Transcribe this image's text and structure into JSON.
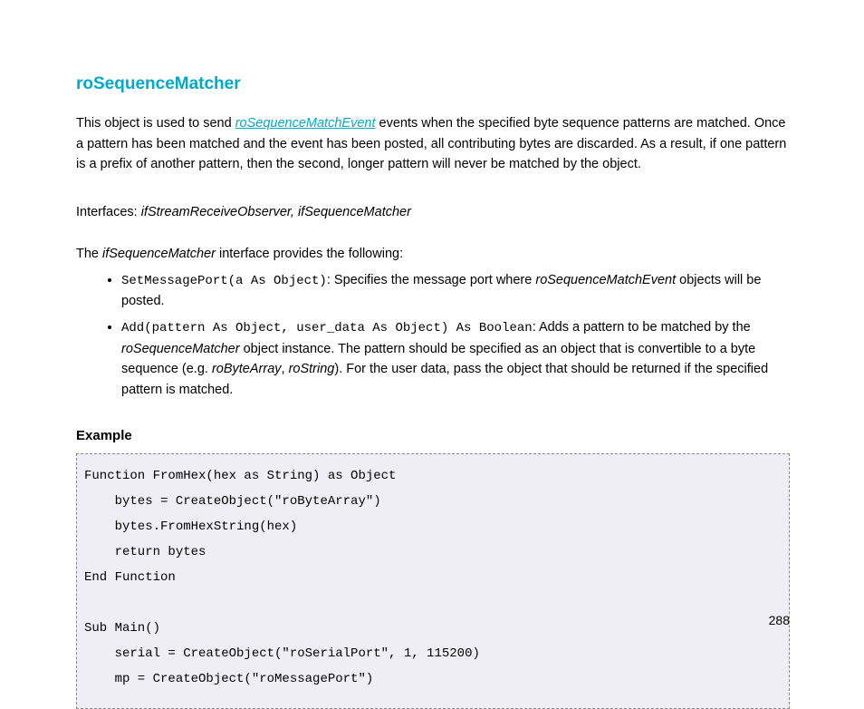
{
  "title": "roSequenceMatcher",
  "intro": {
    "pre_link": "This object is used to send ",
    "link_text": "roSequenceMatchEvent",
    "post_link": " events when the specified byte sequence patterns are matched. Once a pattern has been matched and the event has been posted, all contributing bytes are discarded. As a result, if one pattern is a prefix of another pattern, then the second, longer pattern will never be matched by the object."
  },
  "interfaces_line": {
    "label": "Interfaces: ",
    "value": "ifStreamReceiveObserver, ifSequenceMatcher"
  },
  "provides_line": {
    "pre": "The ",
    "iface": "ifSequenceMatcher",
    "post": " interface provides the following:"
  },
  "methods": [
    {
      "signature": "SetMessagePort(a As Object)",
      "desc_pre": ": Specifies the message port where ",
      "desc_em": "roSequenceMatchEvent",
      "desc_post": " objects will be posted."
    },
    {
      "signature": "Add(pattern As Object, user_data As Object) As Boolean",
      "desc_pre": ": Adds a pattern to be matched by the ",
      "desc_em": "roSequenceMatcher",
      "desc_mid": " object instance. The pattern should be specified as an object that is convertible to a byte sequence (e.g. ",
      "desc_em2": "roByteArray",
      "desc_sep": ", ",
      "desc_em3": "roString",
      "desc_post": "). For the user data, pass the object that should be returned if the specified pattern is matched."
    }
  ],
  "example_heading": "Example",
  "code": "Function FromHex(hex as String) as Object\n    bytes = CreateObject(\"roByteArray\")\n    bytes.FromHexString(hex)\n    return bytes\nEnd Function\n\nSub Main()\n    serial = CreateObject(\"roSerialPort\", 1, 115200)\n    mp = CreateObject(\"roMessagePort\")",
  "page_number": "288"
}
